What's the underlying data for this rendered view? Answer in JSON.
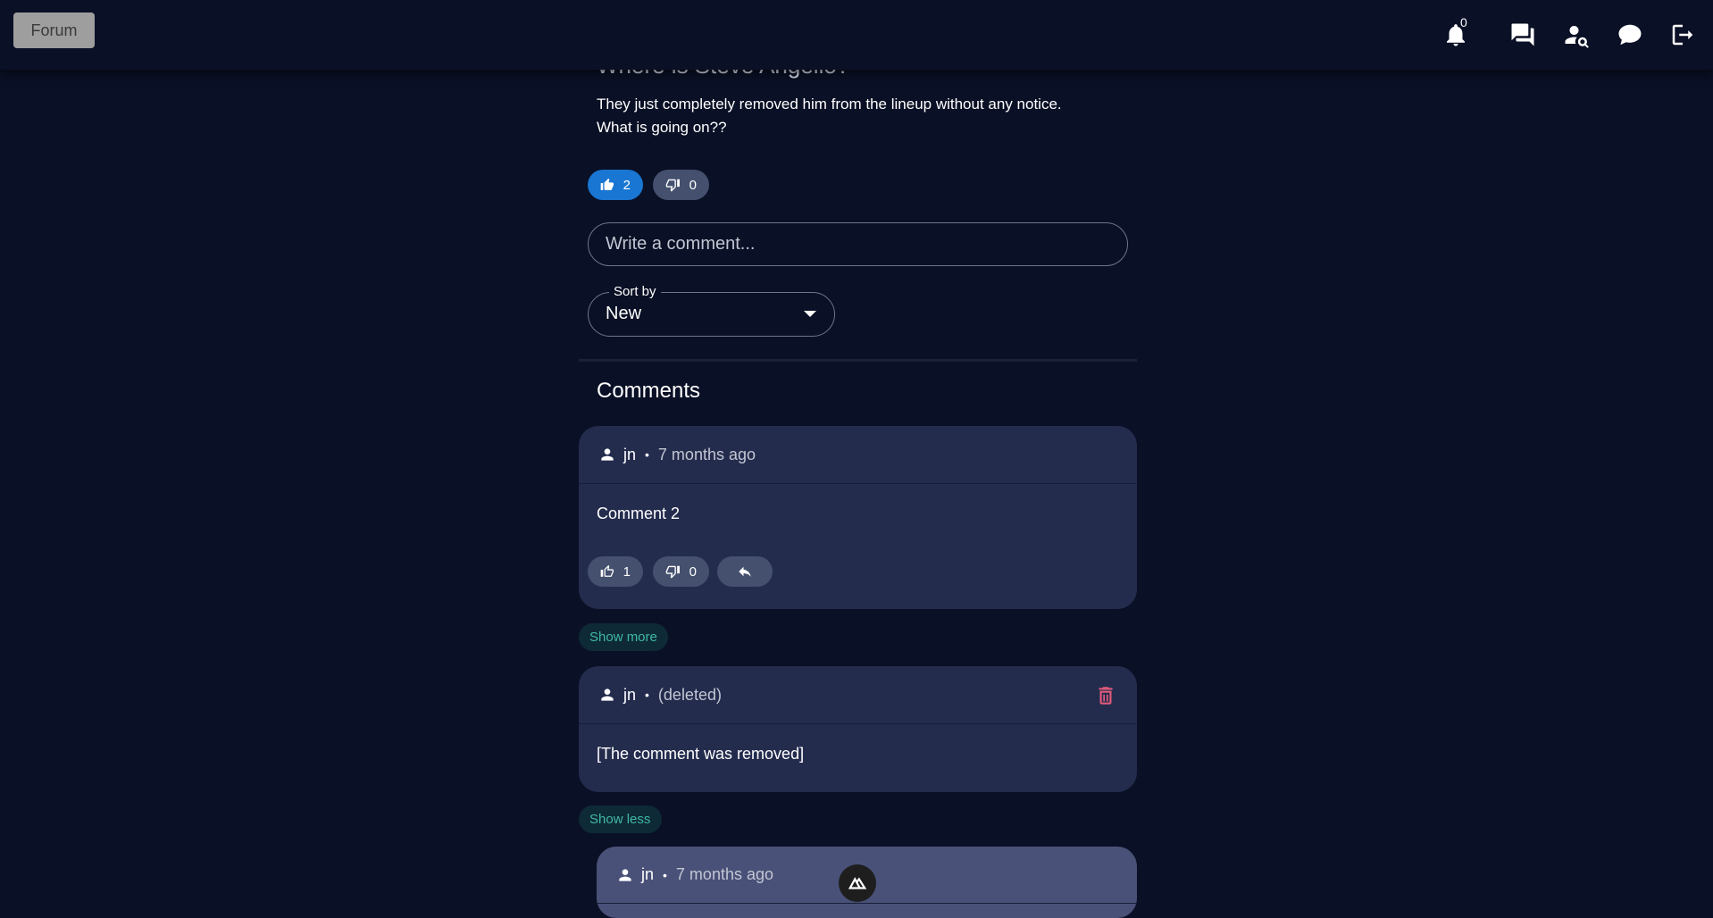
{
  "nav": {
    "forum_label": "Forum",
    "notification_count": "0",
    "icons": [
      "bell-icon",
      "forum-icon",
      "user-search-icon",
      "chat-bubble-icon",
      "logout-icon"
    ]
  },
  "post": {
    "title": "Where is Steve Angello?",
    "body_line1": "They just completely removed him from the lineup without any notice.",
    "body_line2": "What is going on??",
    "likes": "2",
    "dislikes": "0"
  },
  "comment_box": {
    "placeholder": "Write a comment..."
  },
  "sort": {
    "label": "Sort by",
    "value": "New"
  },
  "comments_heading": "Comments",
  "comments": [
    {
      "author": "jn",
      "meta": "7 months ago",
      "text": "Comment 2",
      "likes": "1",
      "dislikes": "0"
    },
    {
      "author": "jn",
      "meta": "(deleted)",
      "text": "[The comment was removed]"
    },
    {
      "author": "jn",
      "meta": "7 months ago"
    }
  ],
  "toggles": {
    "show_more": "Show more",
    "show_less": "Show less"
  },
  "colors": {
    "background": "#0a1025",
    "card": "#242c4e",
    "accent": "#1976d2",
    "toggle_text": "#3fb9a4",
    "delete": "#e05a7a"
  }
}
